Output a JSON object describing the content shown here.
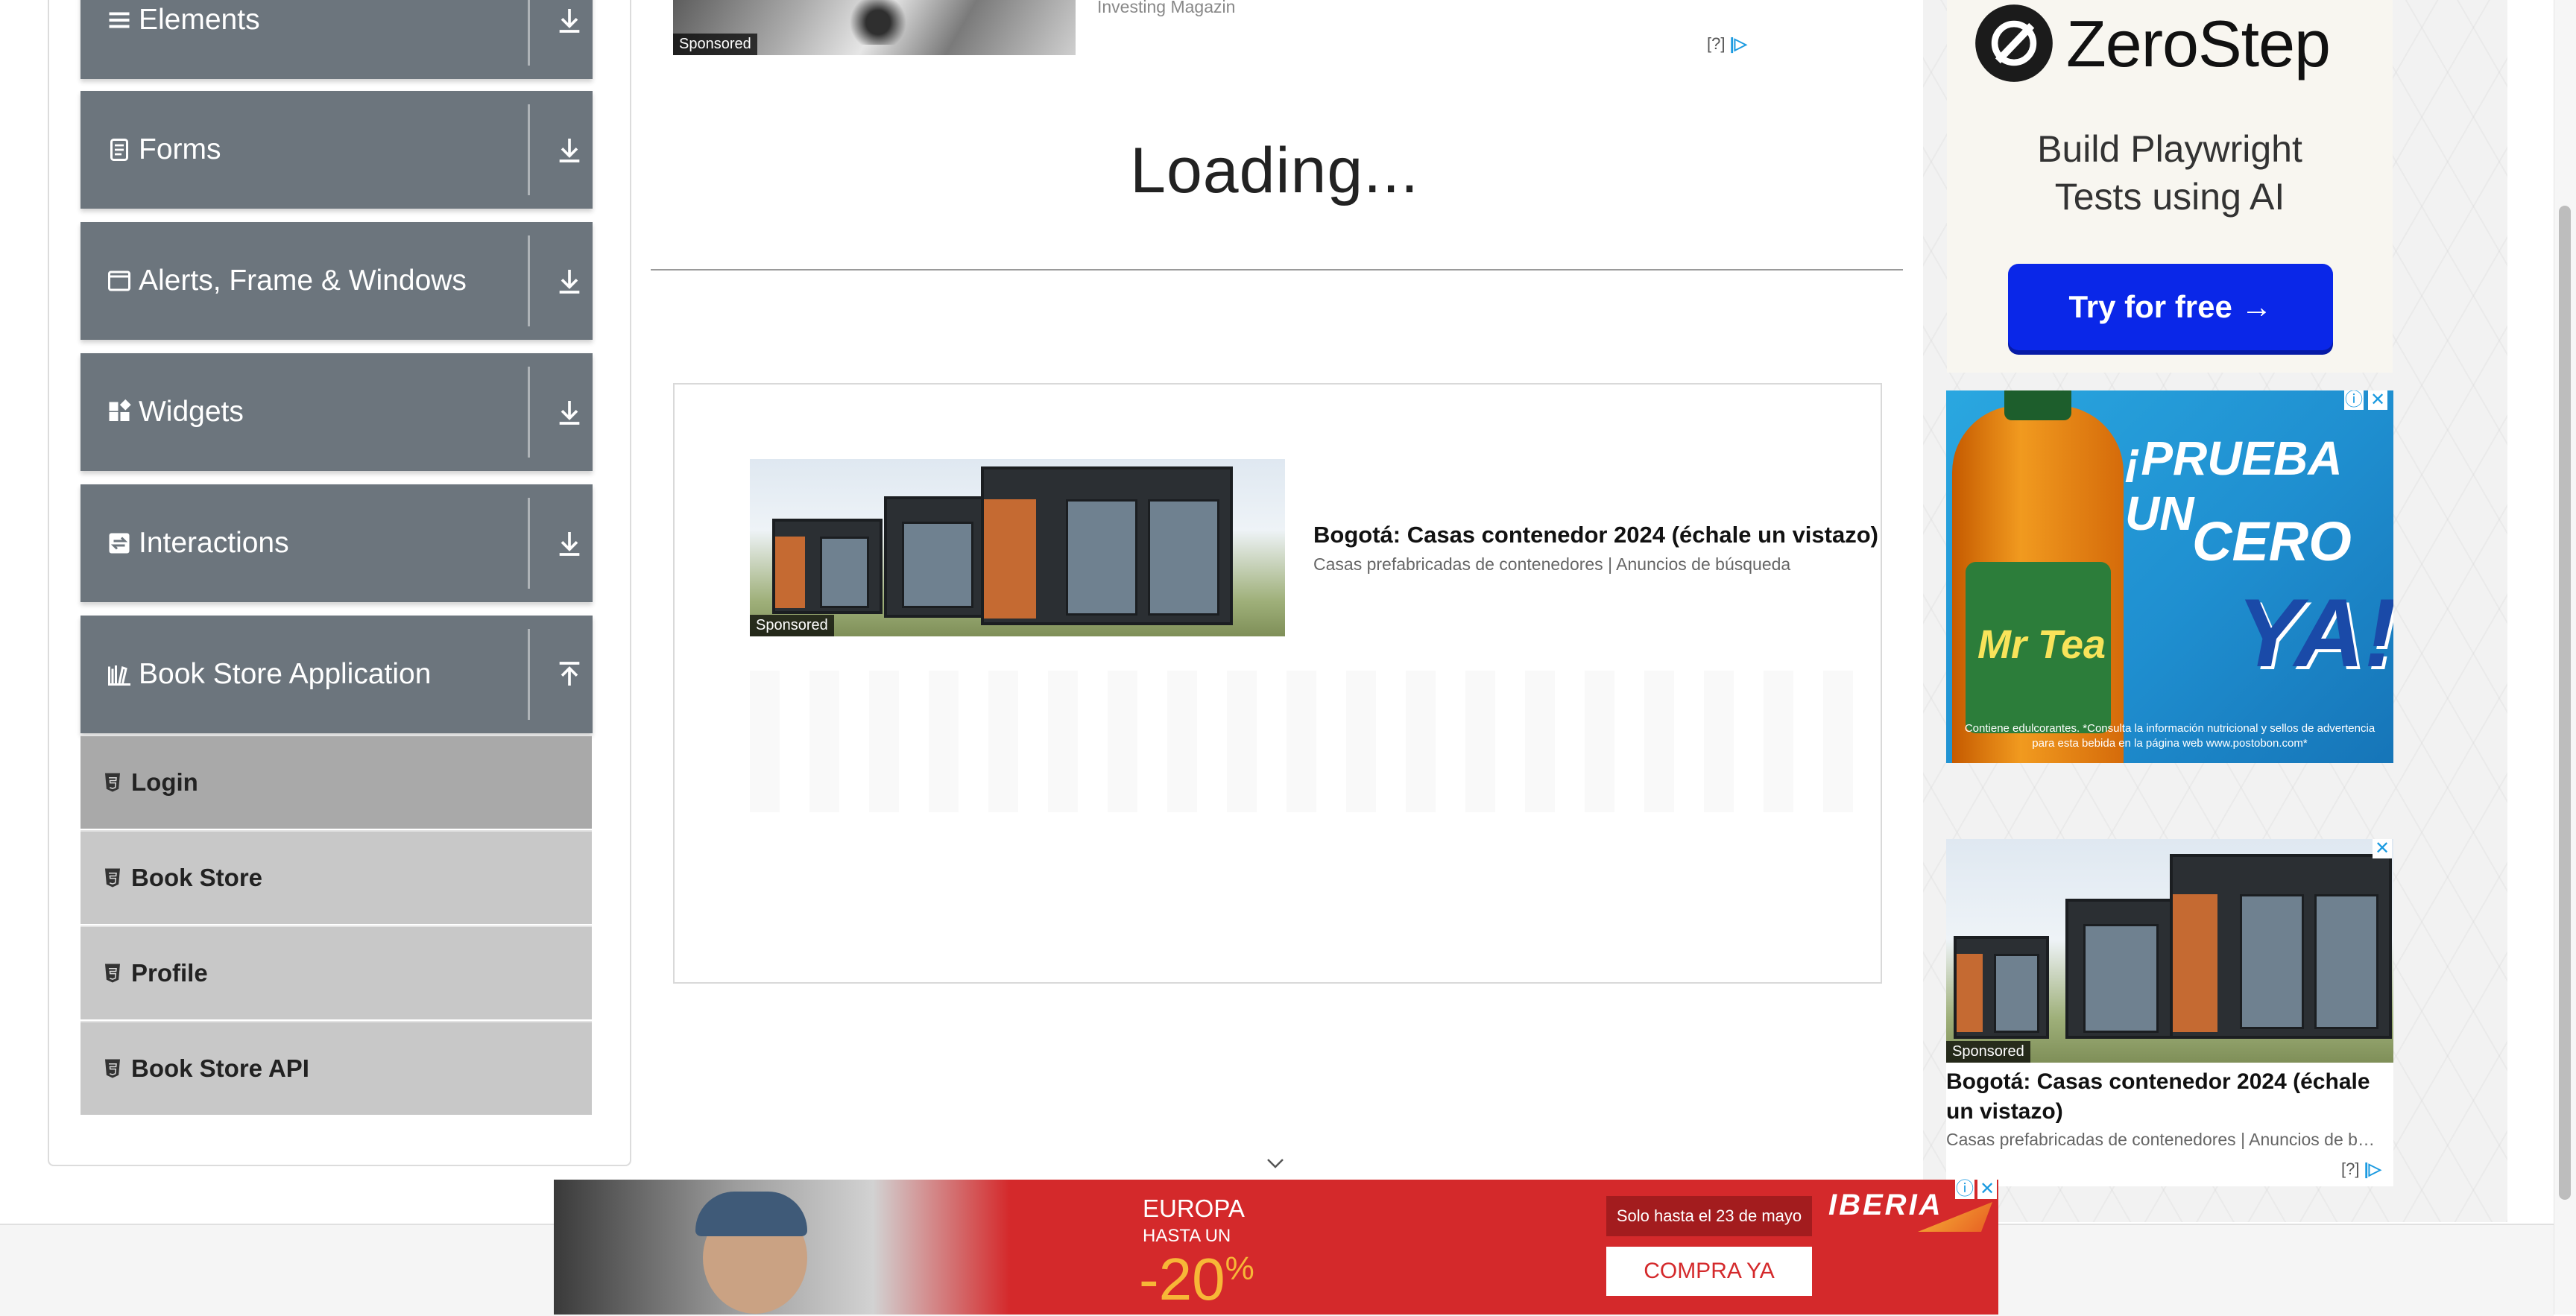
{
  "sidebar": {
    "groups": [
      {
        "label": "Elements",
        "icon": "menu-icon",
        "state": "collapsed"
      },
      {
        "label": "Forms",
        "icon": "form-icon",
        "state": "collapsed"
      },
      {
        "label": "Alerts, Frame & Windows",
        "icon": "window-icon",
        "state": "collapsed"
      },
      {
        "label": "Widgets",
        "icon": "widgets-icon",
        "state": "collapsed"
      },
      {
        "label": "Interactions",
        "icon": "interactions-icon",
        "state": "collapsed"
      },
      {
        "label": "Book Store Application",
        "icon": "books-icon",
        "state": "expanded"
      }
    ],
    "items": [
      {
        "label": "Login",
        "active": true
      },
      {
        "label": "Book Store",
        "active": false
      },
      {
        "label": "Profile",
        "active": false
      },
      {
        "label": "Book Store API",
        "active": false
      }
    ]
  },
  "top_ad": {
    "sponsored": "Sponsored",
    "source": "Investing Magazin",
    "adchoice": "[?]"
  },
  "main": {
    "loading": "Loading..."
  },
  "native_ad": {
    "sponsored": "Sponsored",
    "title": "Bogotá: Casas contenedor 2024 (échale un vistazo)",
    "subtitle": "Casas prefabricadas de contenedores | Anuncios de búsqueda"
  },
  "right_ads": {
    "zerostep": {
      "brand": "ZeroStep",
      "tagline_line1": "Build Playwright",
      "tagline_line2": "Tests using AI",
      "cta": "Try for free →"
    },
    "tea": {
      "headline1": "¡PRUEBA UN",
      "headline2": "CERO",
      "headline3": "YA!",
      "bottle_brand": "Mr Tea",
      "legal": "Contiene edulcorantes. *Consulta la información nutricional y sellos de advertencia para esta bebida en la página web www.postobon.com*"
    },
    "native": {
      "sponsored": "Sponsored",
      "title": "Bogotá: Casas contenedor 2024 (échale un vistazo)",
      "subtitle": "Casas prefabricadas de contenedores | Anuncios de b…",
      "adchoice": "[?]"
    }
  },
  "banner": {
    "europa": "EUROPA",
    "hasta": "HASTA UN",
    "discount": "-20",
    "percent": "%",
    "offer": "Solo hasta el 23 de mayo",
    "cta": "COMPRA YA",
    "brand": "IBERIA"
  },
  "colors": {
    "group_bg": "#6c757d",
    "item_bg": "#c8c8c8",
    "item_active_bg": "#a9a9a9",
    "zerostep_btn": "#0a27e8",
    "banner_red": "#d4292b"
  }
}
